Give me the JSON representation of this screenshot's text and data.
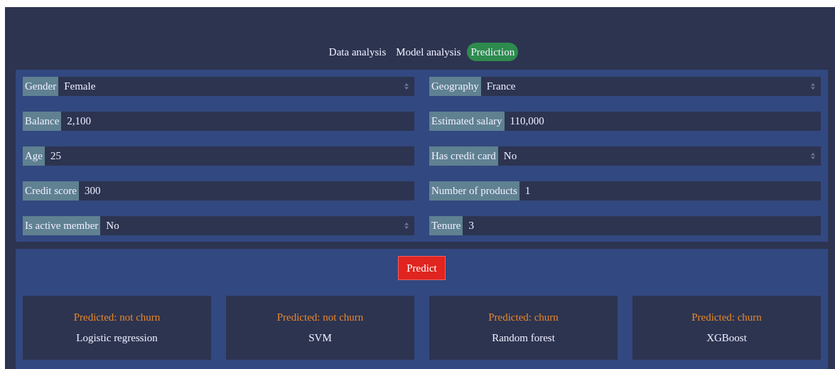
{
  "tabs": [
    {
      "label": "Data analysis",
      "selected": false
    },
    {
      "label": "Model analysis",
      "selected": false
    },
    {
      "label": "Prediction",
      "selected": true
    }
  ],
  "fields": [
    {
      "label": "Gender",
      "value": "Female",
      "kind": "select"
    },
    {
      "label": "Geography",
      "value": "France",
      "kind": "select"
    },
    {
      "label": "Balance",
      "value": "2,100",
      "kind": "input"
    },
    {
      "label": "Estimated salary",
      "value": "110,000",
      "kind": "input"
    },
    {
      "label": "Age",
      "value": "25",
      "kind": "input"
    },
    {
      "label": "Has credit card",
      "value": "No",
      "kind": "select"
    },
    {
      "label": "Credit score",
      "value": "300",
      "kind": "input"
    },
    {
      "label": "Number of products",
      "value": "1",
      "kind": "input"
    },
    {
      "label": "Is active member",
      "value": "No",
      "kind": "select"
    },
    {
      "label": "Tenure",
      "value": "3",
      "kind": "input"
    }
  ],
  "predict_button": "Predict",
  "results": [
    {
      "prediction": "Predicted: not churn",
      "model": "Logistic regression"
    },
    {
      "prediction": "Predicted: not churn",
      "model": "SVM"
    },
    {
      "prediction": "Predicted: churn",
      "model": "Random forest"
    },
    {
      "prediction": "Predicted: churn",
      "model": "XGBoost"
    }
  ]
}
